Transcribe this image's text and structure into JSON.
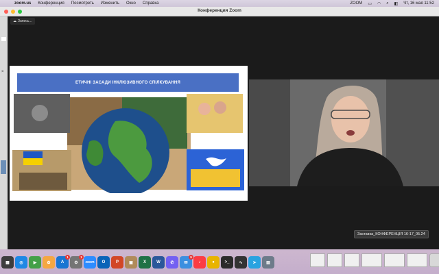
{
  "menubar": {
    "app": "zoom.us",
    "items": [
      "Конференция",
      "Посмотреть",
      "Изменить",
      "Окно",
      "Справка"
    ],
    "status_label": "ZOOM",
    "clock": "Чт, 16 мая  11:52"
  },
  "window": {
    "title": "Конференция Zoom"
  },
  "recording": {
    "label": "Запись..."
  },
  "slide": {
    "heading": "ЕТИЧНІ ЗАСАДИ ІНКЛЮЗИВНОГО СПІЛКУВАННЯ"
  },
  "sidepeek": {
    "close": "×"
  },
  "dock": {
    "tooltip": "Заставка_КОНФЕРЕНЦІЯ 16-17_05.24",
    "icons": [
      {
        "name": "launchpad-icon",
        "color": "#3d3d3d",
        "glyph": "▦"
      },
      {
        "name": "safari-icon",
        "color": "#1e88e5",
        "glyph": "◎"
      },
      {
        "name": "facetime-icon",
        "color": "#43a047",
        "glyph": "▶"
      },
      {
        "name": "photos-icon",
        "color": "#f4a742",
        "glyph": "✿"
      },
      {
        "name": "appstore-icon",
        "color": "#1976d2",
        "glyph": "A",
        "badge": "1"
      },
      {
        "name": "settings-icon",
        "color": "#757575",
        "glyph": "⚙",
        "badge": "1"
      },
      {
        "name": "zoom-icon",
        "color": "#2d8cff",
        "glyph": "zoom"
      },
      {
        "name": "outlook-icon",
        "color": "#0a64b8",
        "glyph": "O"
      },
      {
        "name": "powerpoint-icon",
        "color": "#d24726",
        "glyph": "P"
      },
      {
        "name": "archive-icon",
        "color": "#b08b5a",
        "glyph": "▣"
      },
      {
        "name": "excel-icon",
        "color": "#1e7145",
        "glyph": "X"
      },
      {
        "name": "word-icon",
        "color": "#2b579a",
        "glyph": "W"
      },
      {
        "name": "viber-icon",
        "color": "#7360f2",
        "glyph": "✆"
      },
      {
        "name": "mail-icon",
        "color": "#3b8fe0",
        "glyph": "✉",
        "badge": "9"
      },
      {
        "name": "music-icon",
        "color": "#fc3c44",
        "glyph": "♪"
      },
      {
        "name": "chrome-icon",
        "color": "#e8b400",
        "glyph": "●"
      },
      {
        "name": "terminal-icon",
        "color": "#2b2b2b",
        "glyph": ">_"
      },
      {
        "name": "activity-icon",
        "color": "#333333",
        "glyph": "∿"
      },
      {
        "name": "telegram-icon",
        "color": "#2aa3e0",
        "glyph": "➤"
      },
      {
        "name": "preview-icon",
        "color": "#6d7b8a",
        "glyph": "▤"
      }
    ]
  }
}
